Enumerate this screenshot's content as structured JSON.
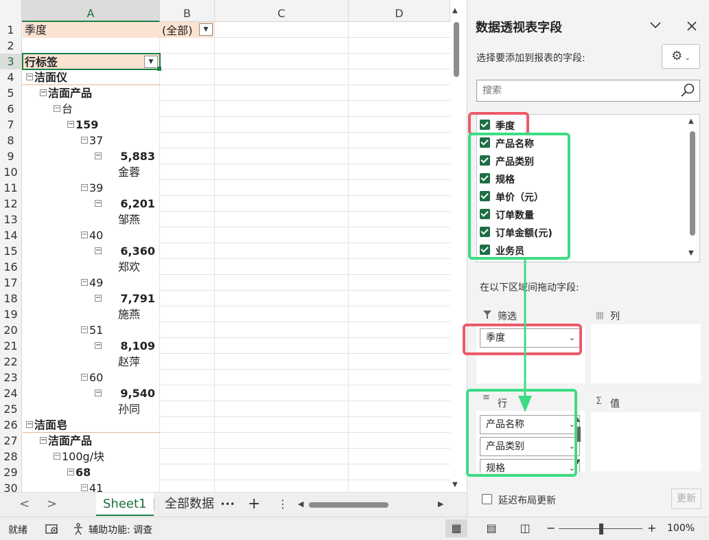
{
  "sheet": {
    "columns": [
      "A",
      "B",
      "C",
      "D"
    ],
    "row_numbers": [
      "1",
      "2",
      "3",
      "4",
      "5",
      "6",
      "7",
      "8",
      "9",
      "10",
      "11",
      "12",
      "13",
      "14",
      "15",
      "16",
      "17",
      "18",
      "19",
      "20",
      "21",
      "22",
      "23",
      "24",
      "25",
      "26",
      "27",
      "28",
      "29",
      "30"
    ],
    "filter_label": "季度",
    "filter_value": "(全部)",
    "row_label_header": "行标签",
    "rows": [
      {
        "r": 4,
        "level": 0,
        "toggle": true,
        "text": "洁面仪",
        "bold": true
      },
      {
        "r": 5,
        "level": 1,
        "toggle": true,
        "text": "洁面产品",
        "bold": true
      },
      {
        "r": 6,
        "level": 2,
        "toggle": true,
        "text": "台",
        "bold": false
      },
      {
        "r": 7,
        "level": 3,
        "toggle": true,
        "text": "159",
        "bold": true
      },
      {
        "r": 8,
        "level": 4,
        "toggle": true,
        "text": "37",
        "bold": false
      },
      {
        "r": 9,
        "level": 5,
        "toggle": true,
        "text": "5,883",
        "bold": true,
        "right": true
      },
      {
        "r": 10,
        "level": 6,
        "toggle": false,
        "text": "金蓉",
        "bold": false
      },
      {
        "r": 11,
        "level": 4,
        "toggle": true,
        "text": "39",
        "bold": false
      },
      {
        "r": 12,
        "level": 5,
        "toggle": true,
        "text": "6,201",
        "bold": true,
        "right": true
      },
      {
        "r": 13,
        "level": 6,
        "toggle": false,
        "text": "邹燕",
        "bold": false
      },
      {
        "r": 14,
        "level": 4,
        "toggle": true,
        "text": "40",
        "bold": false
      },
      {
        "r": 15,
        "level": 5,
        "toggle": true,
        "text": "6,360",
        "bold": true,
        "right": true
      },
      {
        "r": 16,
        "level": 6,
        "toggle": false,
        "text": "郑欢",
        "bold": false
      },
      {
        "r": 17,
        "level": 4,
        "toggle": true,
        "text": "49",
        "bold": false
      },
      {
        "r": 18,
        "level": 5,
        "toggle": true,
        "text": "7,791",
        "bold": true,
        "right": true
      },
      {
        "r": 19,
        "level": 6,
        "toggle": false,
        "text": "施燕",
        "bold": false
      },
      {
        "r": 20,
        "level": 4,
        "toggle": true,
        "text": "51",
        "bold": false
      },
      {
        "r": 21,
        "level": 5,
        "toggle": true,
        "text": "8,109",
        "bold": true,
        "right": true
      },
      {
        "r": 22,
        "level": 6,
        "toggle": false,
        "text": "赵萍",
        "bold": false
      },
      {
        "r": 23,
        "level": 4,
        "toggle": true,
        "text": "60",
        "bold": false
      },
      {
        "r": 24,
        "level": 5,
        "toggle": true,
        "text": "9,540",
        "bold": true,
        "right": true
      },
      {
        "r": 25,
        "level": 6,
        "toggle": false,
        "text": "孙同",
        "bold": false
      },
      {
        "r": 26,
        "level": 0,
        "toggle": true,
        "text": "洁面皂",
        "bold": true
      },
      {
        "r": 27,
        "level": 1,
        "toggle": true,
        "text": "洁面产品",
        "bold": true
      },
      {
        "r": 28,
        "level": 2,
        "toggle": true,
        "text": "100g/块",
        "bold": false
      },
      {
        "r": 29,
        "level": 3,
        "toggle": true,
        "text": "68",
        "bold": true
      },
      {
        "r": 30,
        "level": 4,
        "toggle": true,
        "text": "41",
        "bold": false
      }
    ]
  },
  "tabs": {
    "prev": "<",
    "next": ">",
    "items": [
      "Sheet1",
      "全部数据"
    ],
    "active": 0,
    "more": "•••",
    "add": "+",
    "options": "⋮"
  },
  "panel": {
    "title": "数据透视表字段",
    "choose_label": "选择要添加到报表的字段:",
    "search_placeholder": "搜索",
    "fields": [
      "季度",
      "产品名称",
      "产品类别",
      "规格",
      "单价（元）",
      "订单数量",
      "订单金额(元)",
      "业务员"
    ],
    "drag_label": "在以下区域间拖动字段:",
    "filter_area": {
      "label": "筛选",
      "items": [
        "季度"
      ]
    },
    "column_area": {
      "label": "列"
    },
    "row_area": {
      "label": "行",
      "items": [
        "产品名称",
        "产品类别",
        "规格"
      ]
    },
    "value_area": {
      "label": "值"
    },
    "defer_label": "延迟布局更新",
    "update_label": "更新"
  },
  "status": {
    "ready": "就绪",
    "accessibility": "辅助功能: 调查",
    "zoom": "100%",
    "zoom_minus": "−",
    "zoom_plus": "+"
  },
  "colors": {
    "accent_green": "#1a7f45",
    "highlight_red": "#ec5a6a",
    "highlight_green": "#3ddc84",
    "pivot_header_fill": "#fbe3d2"
  }
}
